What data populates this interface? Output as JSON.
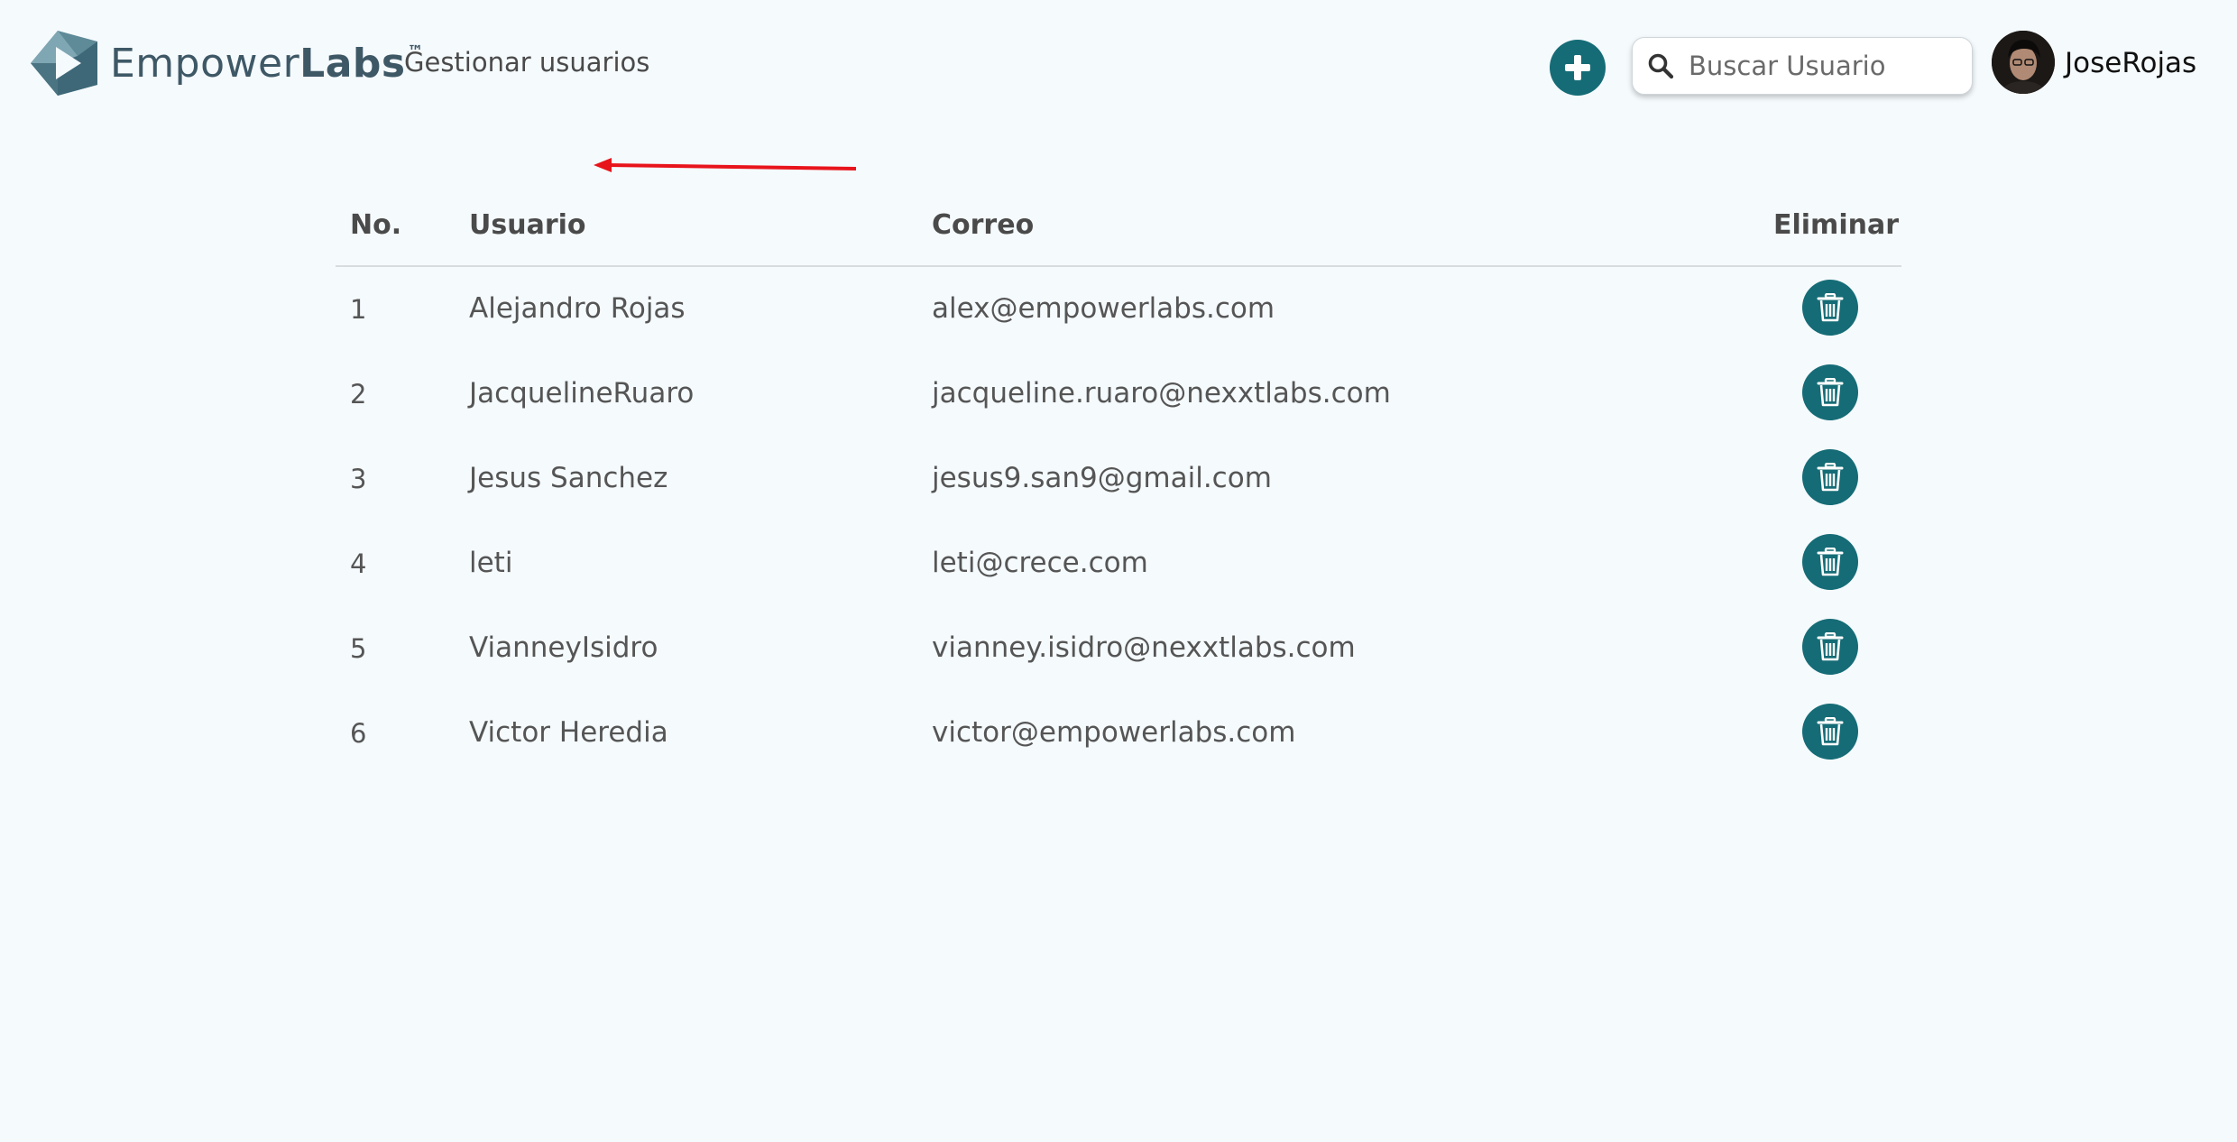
{
  "header": {
    "brand_light": "Empower",
    "brand_bold": "Labs",
    "brand_tm": "™",
    "page_title": "Gestionar usuarios",
    "add_icon": "plus-icon",
    "search_icon": "search-icon",
    "search_placeholder": "Buscar Usuario",
    "user_name": "JoseRojas"
  },
  "colors": {
    "accent": "#156c76",
    "background": "#f5fafd",
    "annotation": "#e8141b"
  },
  "table": {
    "columns": {
      "no": "No.",
      "user": "Usuario",
      "email": "Correo",
      "delete": "Eliminar"
    },
    "delete_icon": "trash-icon",
    "rows": [
      {
        "no": "1",
        "user": "Alejandro Rojas",
        "email": "alex@empowerlabs.com"
      },
      {
        "no": "2",
        "user": "JacquelineRuaro",
        "email": "jacqueline.ruaro@nexxtlabs.com"
      },
      {
        "no": "3",
        "user": "Jesus Sanchez",
        "email": "jesus9.san9@gmail.com"
      },
      {
        "no": "4",
        "user": "leti",
        "email": "leti@crece.com"
      },
      {
        "no": "5",
        "user": "VianneyIsidro",
        "email": "vianney.isidro@nexxtlabs.com"
      },
      {
        "no": "6",
        "user": "Victor Heredia",
        "email": "victor@empowerlabs.com"
      }
    ]
  }
}
